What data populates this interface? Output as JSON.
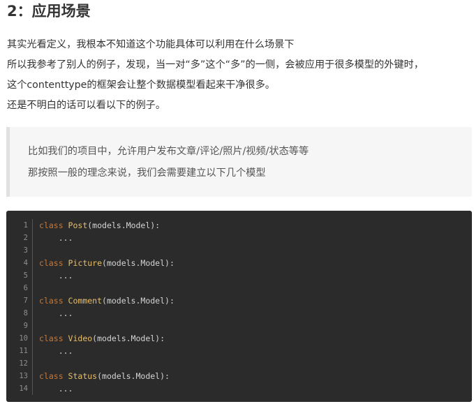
{
  "heading": "2：应用场景",
  "paragraphs": [
    "其实光看定义，我根本不知道这个功能具体可以利用在什么场景下",
    "所以我参考了别人的例子，发现，当一对“多”这个“多”的一侧，会被应用于很多模型的外键时，",
    "这个contenttype的框架会让整个数据模型看起来干净很多。",
    "还是不明白的话可以看以下的例子。"
  ],
  "quote": {
    "lines": [
      "比如我们的项目中，允许用户发布文章/评论/照片/视频/状态等等",
      "那按照一般的理念来说，我们会需要建立以下几个模型"
    ]
  },
  "code": {
    "line_numbers": [
      "1",
      "2",
      "3",
      "4",
      "5",
      "6",
      "7",
      "8",
      "9",
      "10",
      "11",
      "12",
      "13",
      "14"
    ],
    "lines": [
      {
        "kw": "class ",
        "name": "Post",
        "rest": "(models.Model):"
      },
      {
        "kw": "",
        "name": "",
        "rest": "    ..."
      },
      {
        "kw": "",
        "name": "",
        "rest": ""
      },
      {
        "kw": "class ",
        "name": "Picture",
        "rest": "(models.Model):"
      },
      {
        "kw": "",
        "name": "",
        "rest": "    ..."
      },
      {
        "kw": "",
        "name": "",
        "rest": ""
      },
      {
        "kw": "class ",
        "name": "Comment",
        "rest": "(models.Model):"
      },
      {
        "kw": "",
        "name": "",
        "rest": "    ..."
      },
      {
        "kw": "",
        "name": "",
        "rest": ""
      },
      {
        "kw": "class ",
        "name": "Video",
        "rest": "(models.Model):"
      },
      {
        "kw": "",
        "name": "",
        "rest": "    ..."
      },
      {
        "kw": "",
        "name": "",
        "rest": ""
      },
      {
        "kw": "class ",
        "name": "Status",
        "rest": "(models.Model):"
      },
      {
        "kw": "",
        "name": "",
        "rest": "    ..."
      }
    ]
  },
  "colors": {
    "code_background": "#2b2b2b",
    "keyword": "#cc7832",
    "class_name": "#e8bf6a",
    "quote_background": "#f6f6f6"
  }
}
